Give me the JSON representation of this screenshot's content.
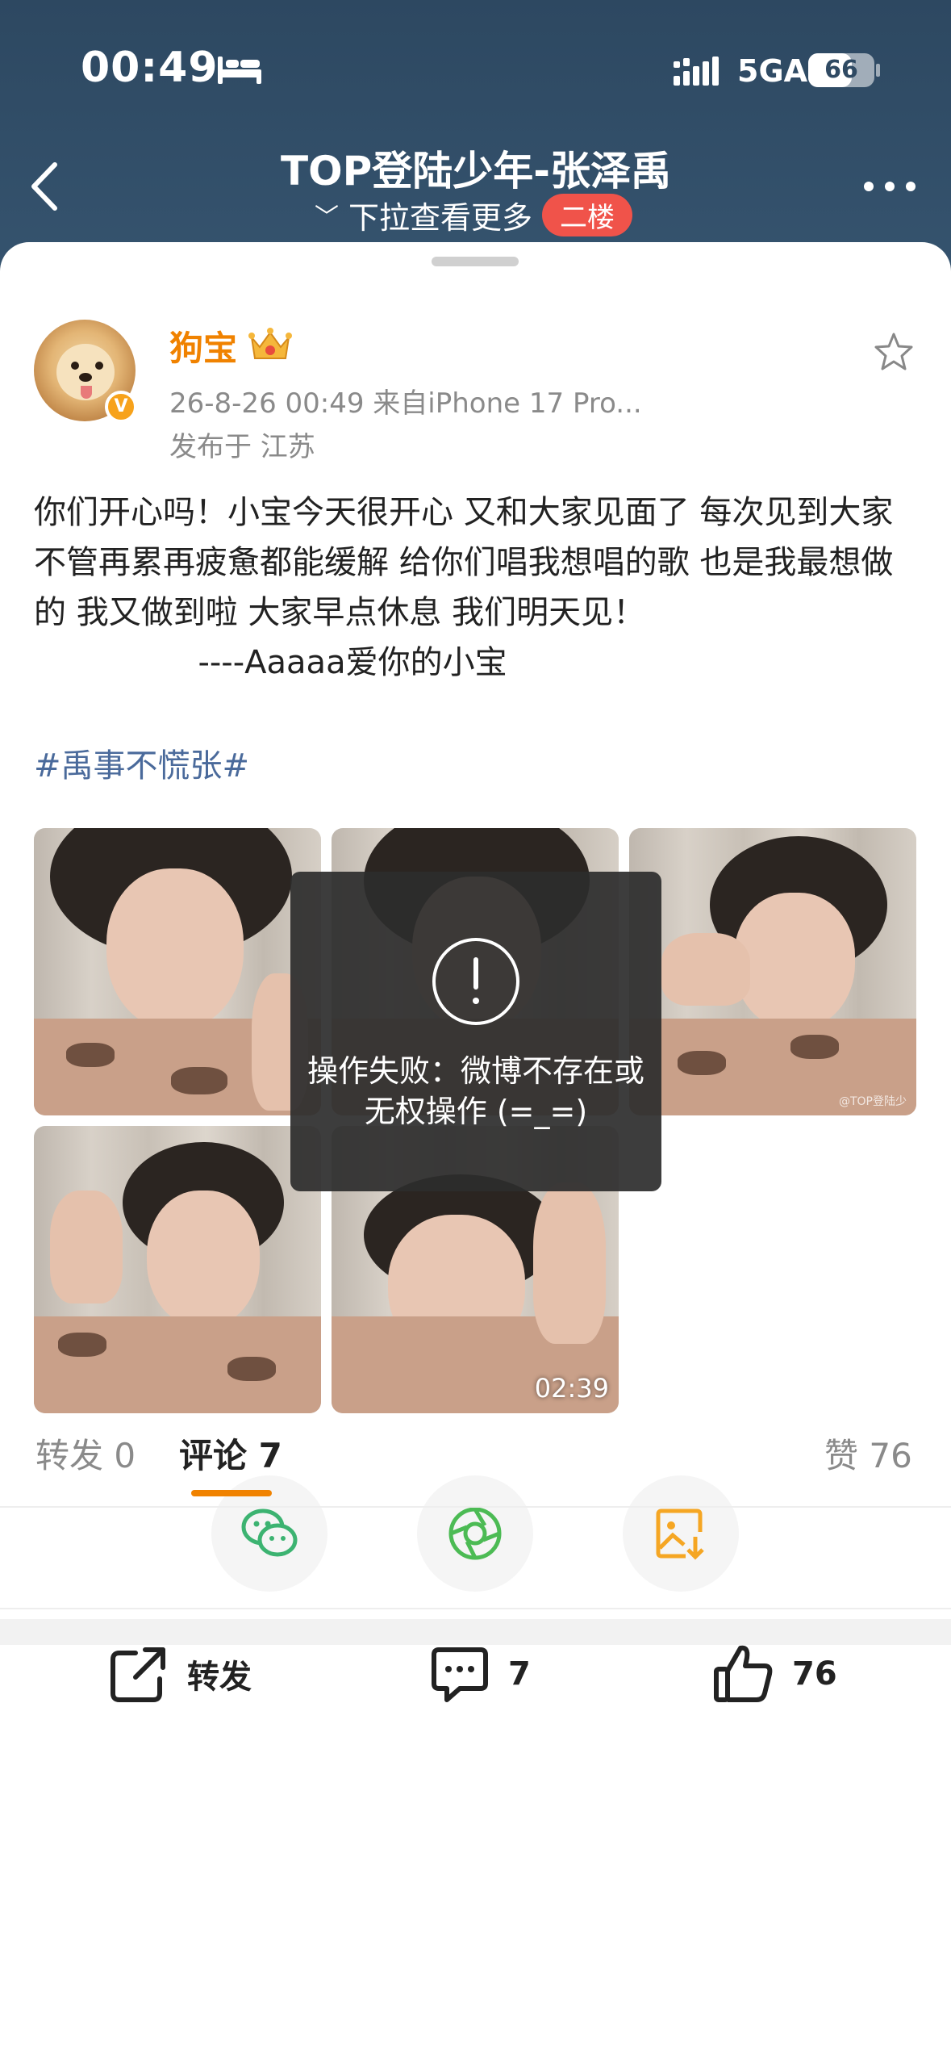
{
  "status_bar": {
    "time": "00:49",
    "network": "5GA",
    "battery": "66",
    "battery_level": 0.66
  },
  "nav": {
    "title": "TOP登陆少年-张泽禹",
    "subtitle": "下拉查看更多",
    "floor_badge": "二楼"
  },
  "post": {
    "username": "狗宝",
    "meta": "26-8-26 00:49  来自iPhone 17 Pro...",
    "location": "发布于 江苏",
    "body": "你们开心吗！小宝今天很开心 又和大家见面了 每次见到大家不管再累再疲惫都能缓解 给你们唱我想唱的歌 也是我最想做的 我又做到啦 大家早点休息 我们明天见！\n                ----Aaaaa爱你的小宝",
    "hashtag": "#禹事不慌张#",
    "video_duration": "02:39",
    "watermark": "@TOP登陆少",
    "accent_color": "#f08200"
  },
  "toast": {
    "message": "操作失败：微博不存在或无权操作 (=_=)"
  },
  "share": {
    "icons": [
      "wechat-icon",
      "moments-icon",
      "save-image-icon"
    ]
  },
  "tabs": {
    "repost_label": "转发",
    "repost_count": "0",
    "comment_label": "评论",
    "comment_count": "7",
    "like_label": "赞",
    "like_count": "76"
  },
  "bottom_bar": {
    "repost": "转发",
    "comments": "7",
    "likes": "76"
  }
}
